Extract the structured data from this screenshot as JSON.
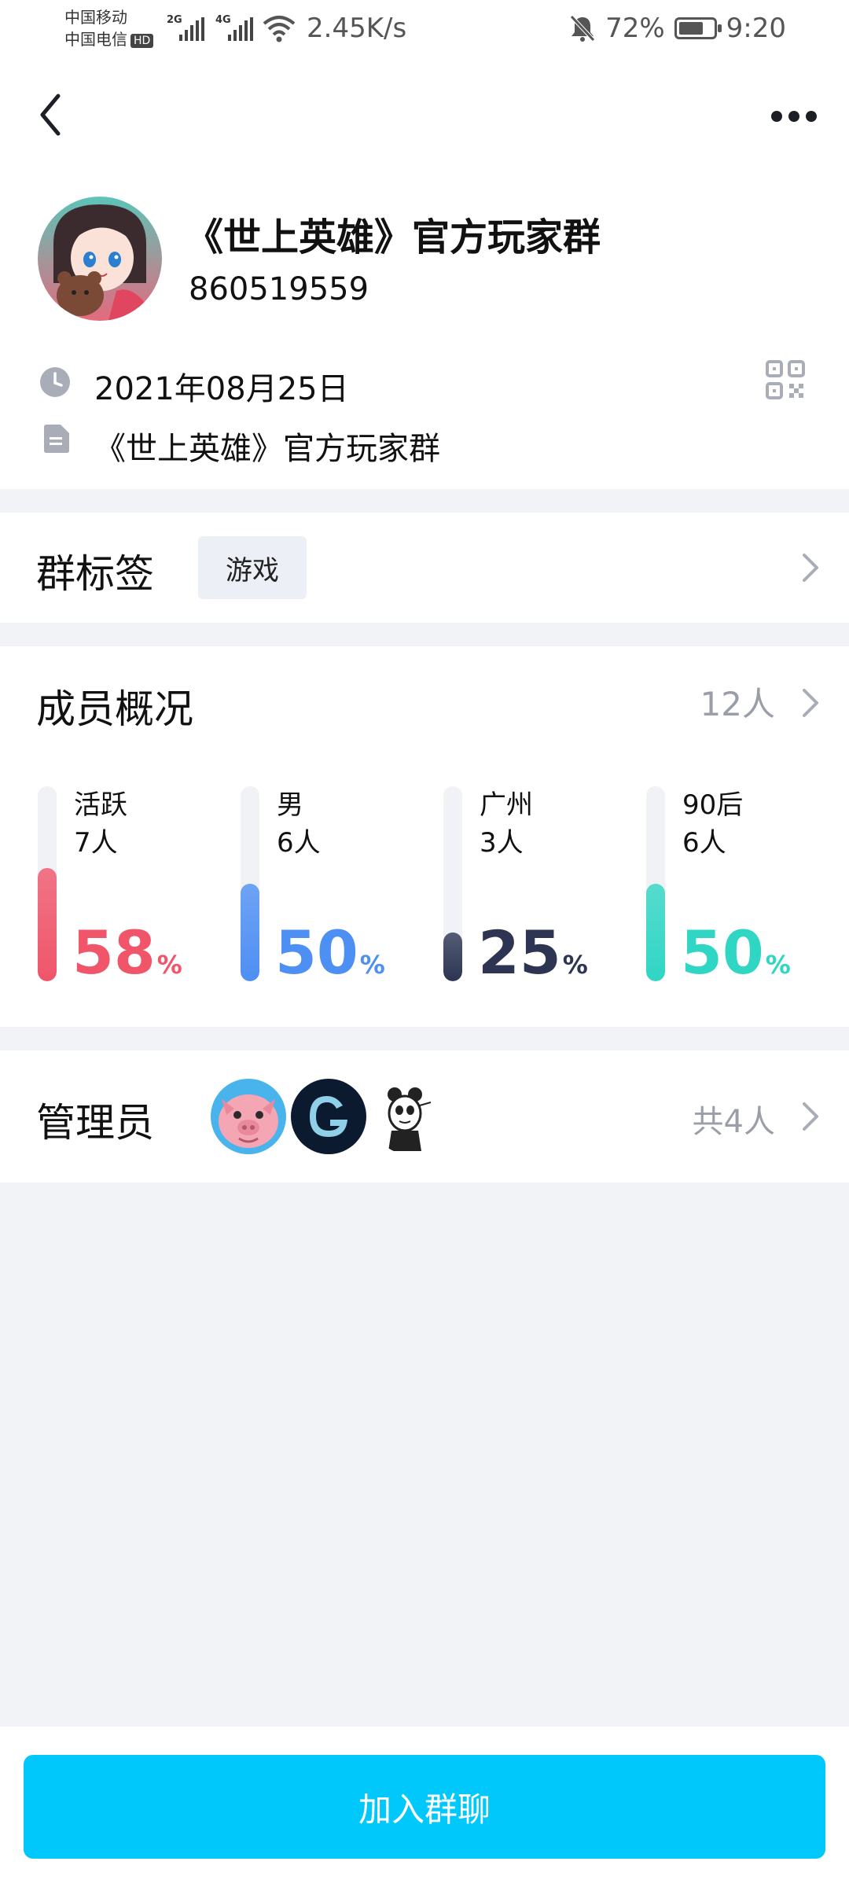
{
  "status_bar": {
    "carrier_1": "中国移动",
    "carrier_2": "中国电信",
    "hd_badge": "HD",
    "sig_1_tag": "2G",
    "sig_2_tag": "4G",
    "net_speed": "2.45K/s",
    "battery": "72%",
    "battery_level": 0.72,
    "time": "9:20"
  },
  "group": {
    "name": "《世上英雄》官方玩家群",
    "id": "860519559",
    "created_date": "2021年08月25日",
    "description": "《世上英雄》官方玩家群"
  },
  "tags": {
    "title": "群标签",
    "items": [
      "游戏"
    ]
  },
  "members": {
    "title": "成员概况",
    "count": "12人",
    "stats": [
      {
        "label": "活跃",
        "count": "7人",
        "percent": "58",
        "unit": "%",
        "value": 58,
        "color": "#f0556a"
      },
      {
        "label": "男",
        "count": "6人",
        "percent": "50",
        "unit": "%",
        "value": 50,
        "color": "#4e8ff3"
      },
      {
        "label": "广州",
        "count": "3人",
        "percent": "25",
        "unit": "%",
        "value": 25,
        "color": "#2d3553"
      },
      {
        "label": "90后",
        "count": "6人",
        "percent": "50",
        "unit": "%",
        "value": 50,
        "color": "#2fd6c4"
      }
    ]
  },
  "admins": {
    "title": "管理员",
    "count": "共4人"
  },
  "actions": {
    "join_label": "加入群聊"
  },
  "colors": {
    "accent": "#00c8fb",
    "page_bg": "#f2f3f7",
    "muted_text": "#9a9ea8"
  }
}
